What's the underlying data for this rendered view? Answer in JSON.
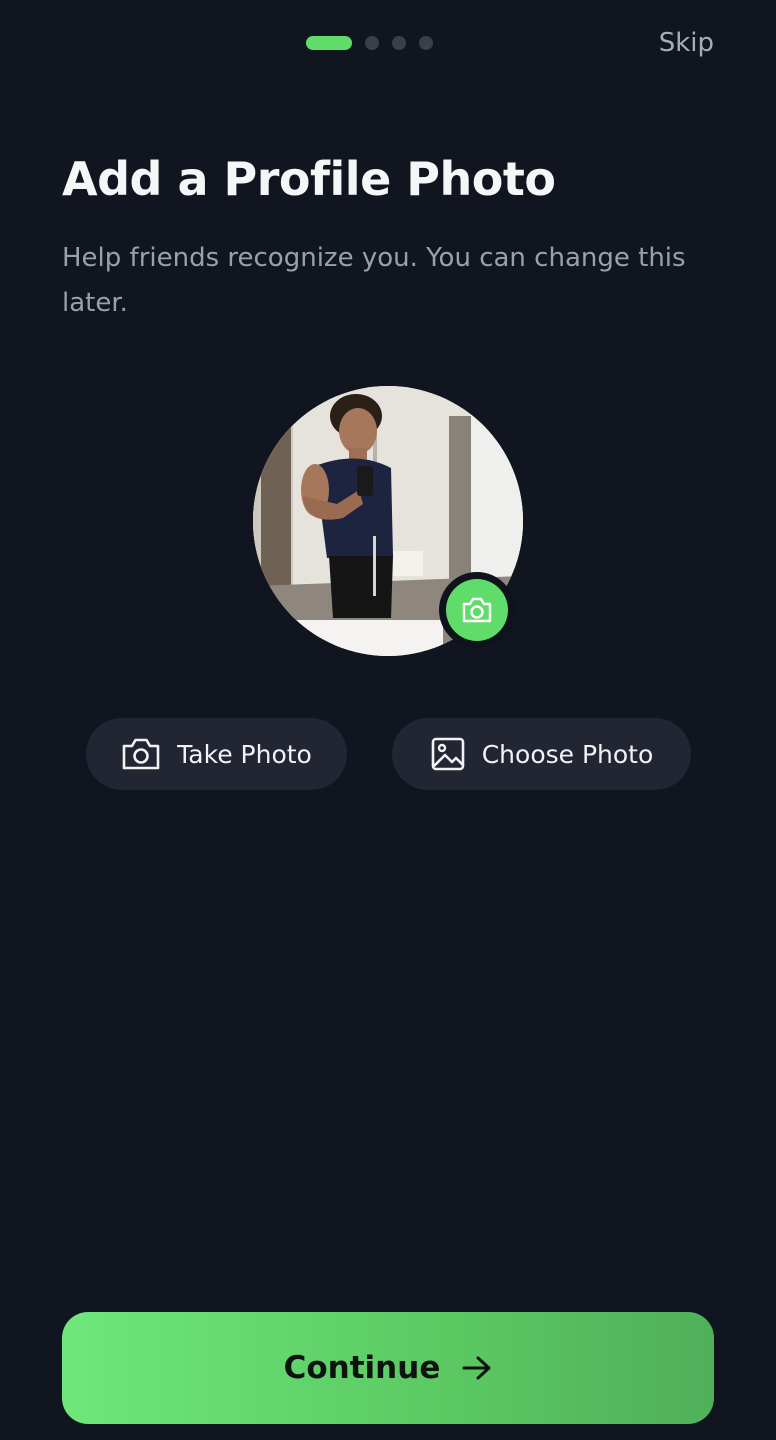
{
  "onboarding": {
    "step_count": 4,
    "current_step": 1,
    "skip_label": "Skip"
  },
  "header": {
    "title": "Add a Profile Photo",
    "subtitle": "Help friends recognize you. You can change this later."
  },
  "actions": {
    "take_photo_label": "Take Photo",
    "take_photo_icon": "camera-icon",
    "choose_photo_label": "Choose Photo",
    "choose_photo_icon": "image-icon"
  },
  "footer": {
    "continue_label": "Continue",
    "continue_icon": "arrow-right-icon"
  },
  "colors": {
    "background": "#11151f",
    "accent": "#5fdc6a",
    "pill_bg": "#222632",
    "muted_text": "#9aa0aa"
  }
}
